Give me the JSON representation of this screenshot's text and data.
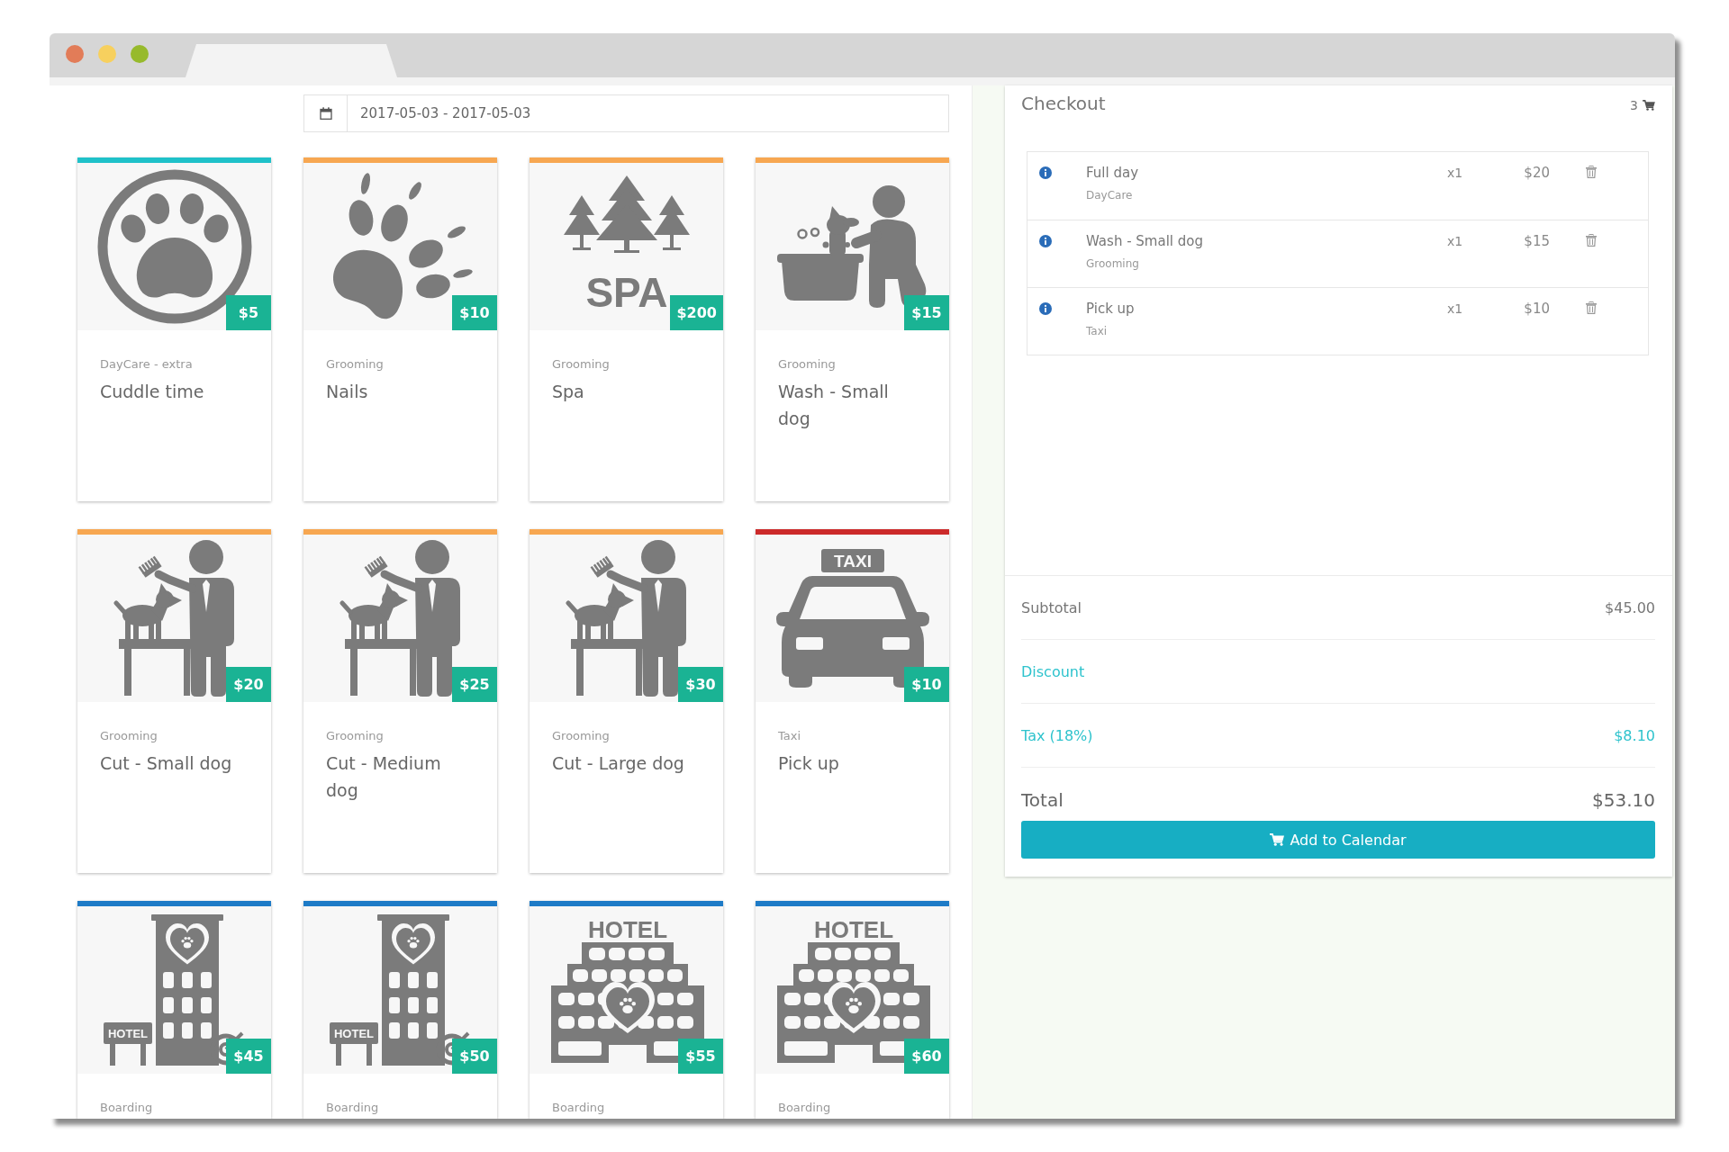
{
  "date_range": {
    "value": "2017-05-03 - 2017-05-03"
  },
  "services": [
    {
      "kind": "paw-circle",
      "category": "DayCare - extra",
      "title": "Cuddle time",
      "price": "$5",
      "color": "#1fc1c9"
    },
    {
      "kind": "paw-print",
      "category": "Grooming",
      "title": "Nails",
      "price": "$10",
      "color": "#f7a751"
    },
    {
      "kind": "spa",
      "image_text": "SPA",
      "category": "Grooming",
      "title": "Spa",
      "price": "$200",
      "color": "#f7a751"
    },
    {
      "kind": "bath",
      "category": "Grooming",
      "title": "Wash - Small dog",
      "price": "$15",
      "color": "#f7a751"
    },
    {
      "kind": "grooming",
      "category": "Grooming",
      "title": "Cut - Small dog",
      "price": "$20",
      "color": "#f7a751"
    },
    {
      "kind": "grooming",
      "category": "Grooming",
      "title": "Cut - Medium dog",
      "price": "$25",
      "color": "#f7a751"
    },
    {
      "kind": "grooming",
      "category": "Grooming",
      "title": "Cut - Large dog",
      "price": "$30",
      "color": "#f7a751"
    },
    {
      "kind": "taxi",
      "image_text": "TAXI",
      "category": "Taxi",
      "title": "Pick up",
      "price": "$10",
      "color": "#cc2a2a"
    },
    {
      "kind": "hotel-tower",
      "image_text": "HOTEL",
      "category": "Boarding",
      "price": "$45",
      "color": "#1e7bc7"
    },
    {
      "kind": "hotel-tower",
      "image_text": "HOTEL",
      "category": "Boarding",
      "price": "$50",
      "color": "#1e7bc7"
    },
    {
      "kind": "hotel-wide",
      "image_text": "HOTEL",
      "category": "Boarding",
      "price": "$55",
      "color": "#1e7bc7"
    },
    {
      "kind": "hotel-wide",
      "image_text": "HOTEL",
      "category": "Boarding",
      "price": "$60",
      "color": "#1e7bc7"
    }
  ],
  "checkout": {
    "title": "Checkout",
    "cart_count": "3",
    "items": [
      {
        "name": "Full day",
        "category": "DayCare",
        "quantity": "x1",
        "price": "$20"
      },
      {
        "name": "Wash - Small dog",
        "category": "Grooming",
        "quantity": "x1",
        "price": "$15"
      },
      {
        "name": "Pick up",
        "category": "Taxi",
        "quantity": "x1",
        "price": "$10"
      }
    ],
    "summary": [
      {
        "kind": "plain",
        "label": "Subtotal",
        "value": "$45.00"
      },
      {
        "kind": "link",
        "label": "Discount"
      },
      {
        "kind": "accent",
        "label": "Tax (18%)",
        "value": "$8.10"
      }
    ],
    "total": {
      "label": "Total",
      "value": "$53.10"
    },
    "button": "Add to Calendar"
  }
}
